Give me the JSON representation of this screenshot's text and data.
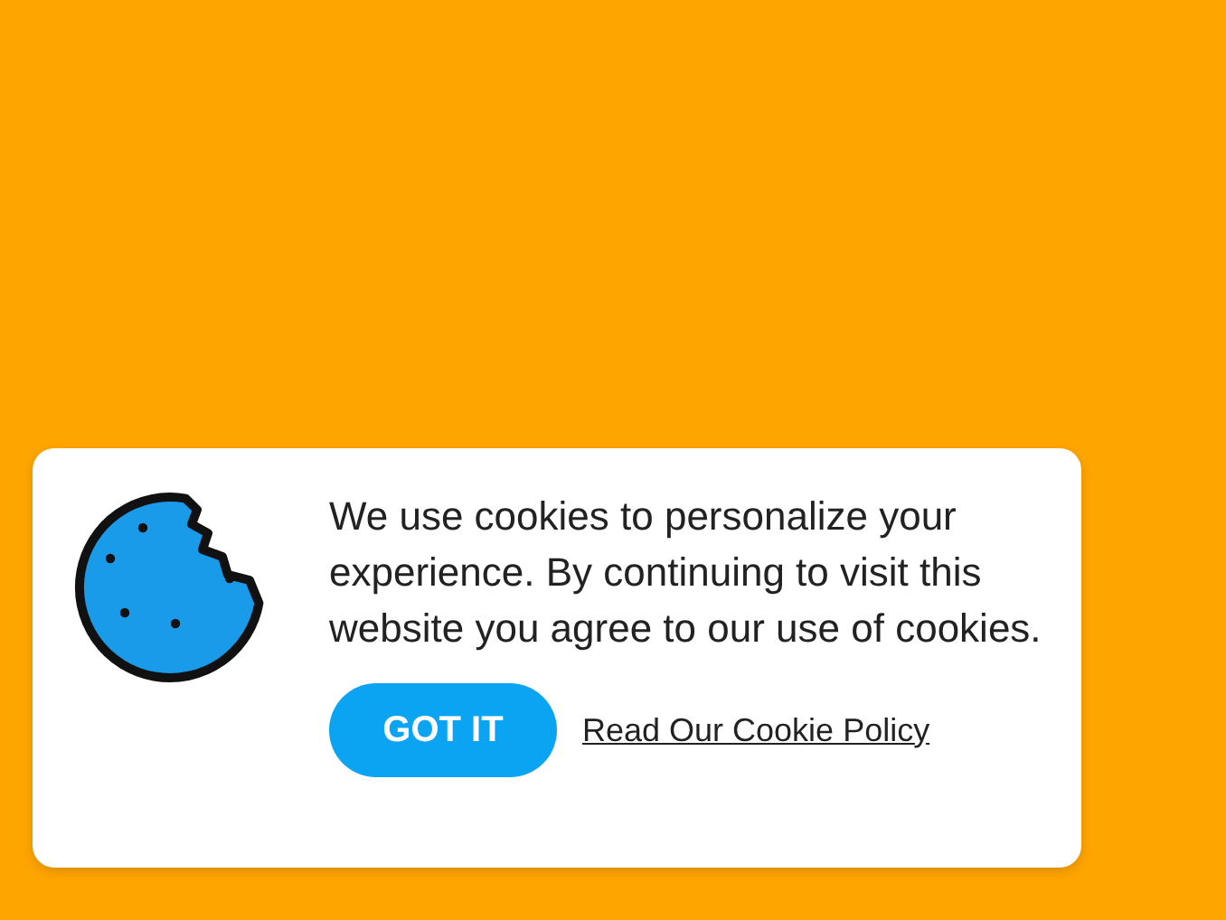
{
  "cookie_banner": {
    "message": "We use cookies to personalize your experience. By continuing to visit this website you agree to our use of cookies.",
    "accept_button": "GOT IT",
    "policy_link": "Read Our Cookie Policy"
  }
}
